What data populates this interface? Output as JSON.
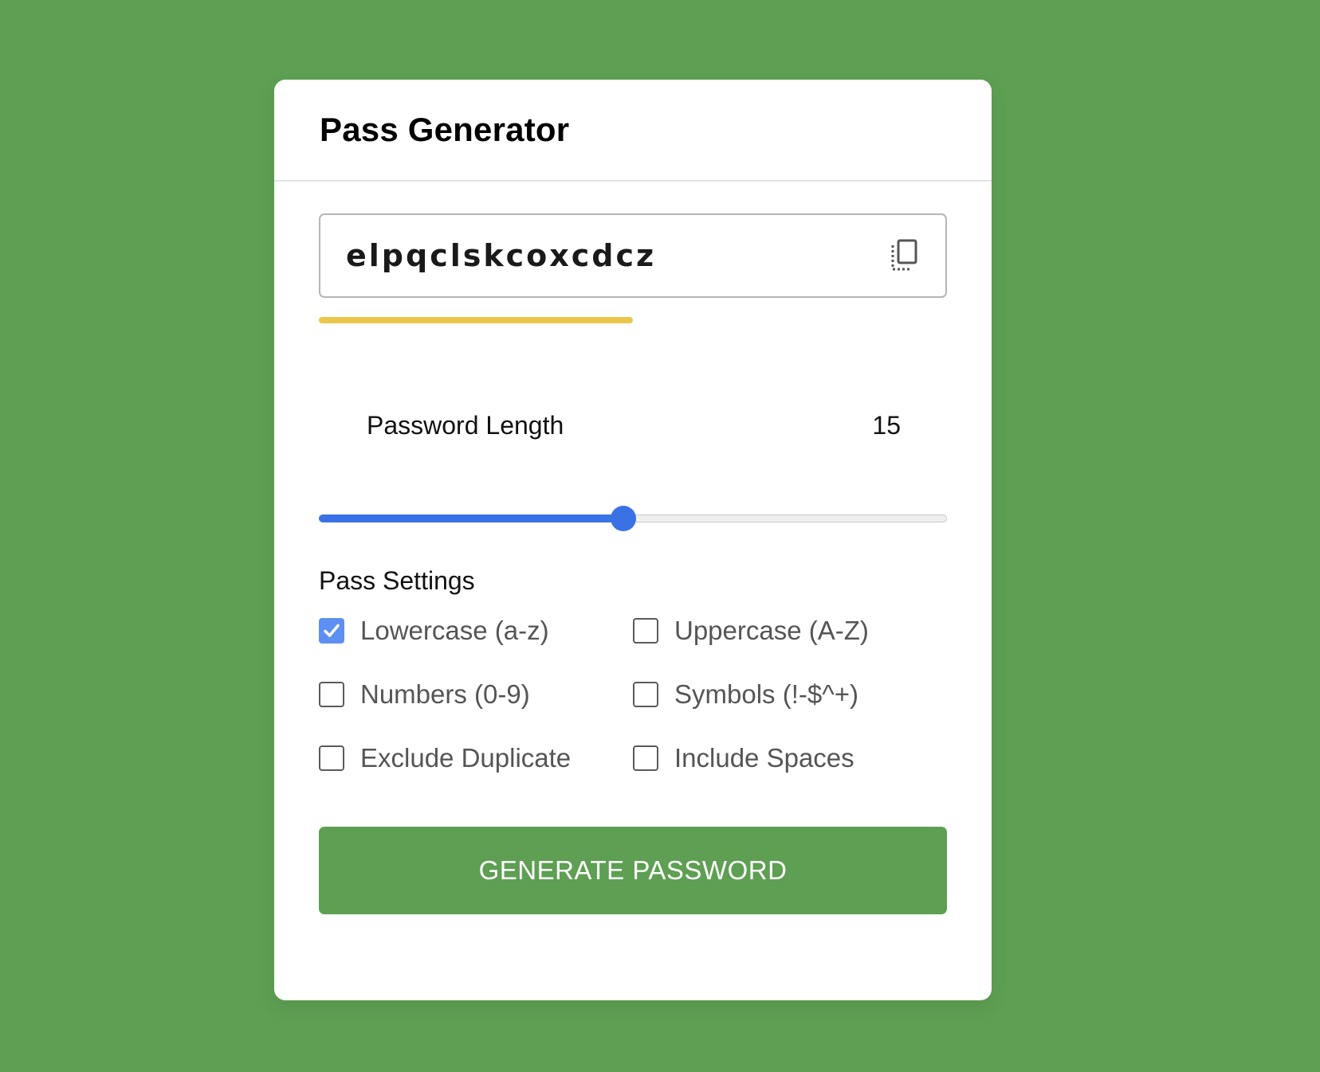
{
  "app": {
    "title": "Pass Generator"
  },
  "password": {
    "value": "elpqclskcoxcdcz",
    "copy_icon": "copy-icon",
    "strength_fraction": 0.5,
    "strength_color": "#e9c54a"
  },
  "length": {
    "label": "Password Length",
    "value": "15",
    "slider_fraction": 0.485,
    "slider_color": "#3a72e6"
  },
  "settings": {
    "title": "Pass Settings",
    "options": [
      {
        "label": "Lowercase (a-z)",
        "checked": true
      },
      {
        "label": "Uppercase (A-Z)",
        "checked": false
      },
      {
        "label": "Numbers (0-9)",
        "checked": false
      },
      {
        "label": "Symbols (!-$^+)",
        "checked": false
      },
      {
        "label": "Exclude Duplicate",
        "checked": false
      },
      {
        "label": "Include Spaces",
        "checked": false
      }
    ]
  },
  "actions": {
    "generate_label": "GENERATE PASSWORD"
  },
  "colors": {
    "background": "#5e9f53",
    "accent": "#5e9f53",
    "checkbox_checked": "#5e8ff2"
  }
}
